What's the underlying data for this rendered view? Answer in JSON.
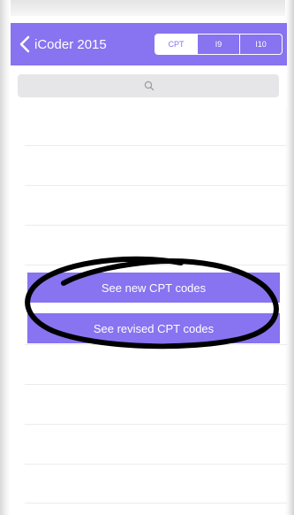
{
  "navbar": {
    "back_label": "iCoder 2015",
    "segments": [
      {
        "label": "CPT",
        "selected": true
      },
      {
        "label": "I9",
        "selected": false
      },
      {
        "label": "I10",
        "selected": false
      }
    ]
  },
  "search": {
    "placeholder": ""
  },
  "buttons": {
    "new_codes": "See new CPT codes",
    "revised_codes": "See revised CPT codes"
  },
  "colors": {
    "accent": "#8873f0",
    "search_field": "#e6e6e9",
    "separator": "#ececec",
    "annotation_ink": "#000000"
  },
  "icons": {
    "back": "chevron-left-icon",
    "search": "magnifier-icon"
  }
}
